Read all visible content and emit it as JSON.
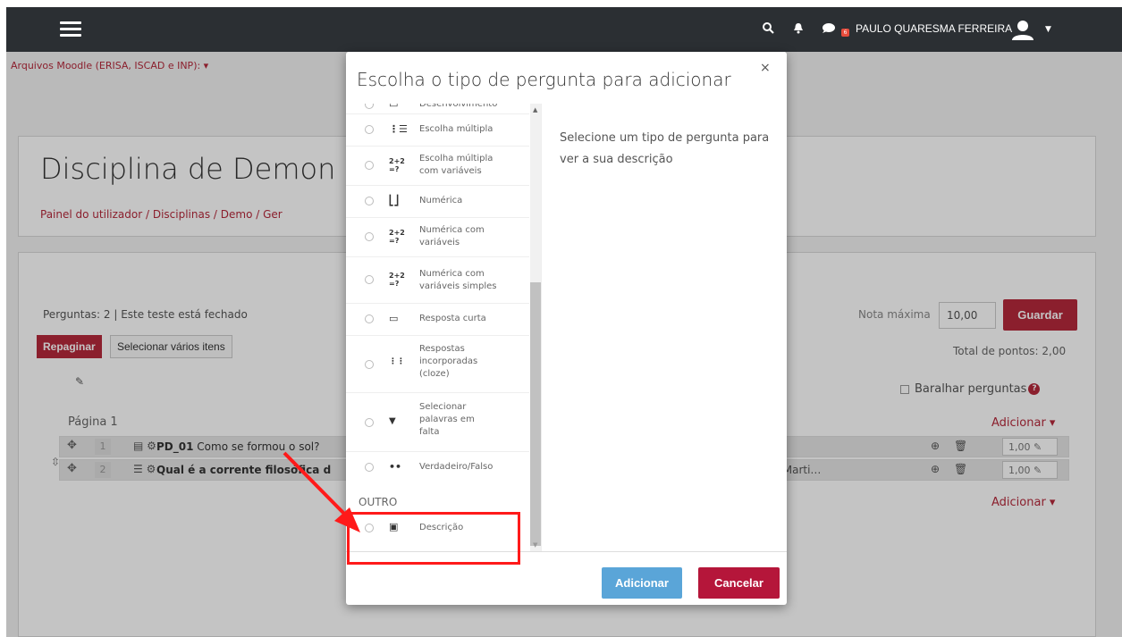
{
  "topbar": {
    "user_name": "PAULO QUARESMA FERREIRA",
    "notification_count": "6"
  },
  "course_menu": "Arquivos Moodle (ERISA, ISCAD e INP): ▾",
  "course": {
    "title": "Disciplina de Demon",
    "breadcrumb": "Painel do utilizador  /  Disciplinas  /  Demo  /  Ger"
  },
  "quiz": {
    "info": "Perguntas: 2 | Este teste está fechado",
    "repaginar": "Repaginar",
    "select_multiple": "Selecionar vários itens",
    "nota_label": "Nota máxima",
    "nota_value": "10,00",
    "guardar": "Guardar",
    "total": "Total de pontos: 2,00",
    "shuffle": "Baralhar perguntas",
    "page": "Página 1",
    "add_label": "Adicionar ▾",
    "questions": [
      {
        "num": "1",
        "name": "PD_01",
        "text": "Como se formou o sol?",
        "extra": "",
        "mark": "1,00"
      },
      {
        "num": "2",
        "name": "",
        "text": "Qual é a corrente filosófica d",
        "extra": "r Marti…",
        "mark": "1,00"
      }
    ]
  },
  "modal": {
    "title": "Escolha o tipo de pergunta para adicionar",
    "close": "×",
    "partial_top": "Desenvolvimento",
    "types": [
      {
        "icon": "⋮☰",
        "label": "Escolha múltipla"
      },
      {
        "icon": "2+2 =?",
        "label": "Escolha múltipla com variáveis"
      },
      {
        "icon": "⎣⎦",
        "label": "Numérica"
      },
      {
        "icon": "2+2 =?",
        "label": "Numérica com variáveis"
      },
      {
        "icon": "2+2 =?",
        "label": "Numérica com variáveis simples"
      },
      {
        "icon": "▭",
        "label": "Resposta curta"
      },
      {
        "icon": "⋮⋮",
        "label": "Respostas incorporadas (cloze)"
      },
      {
        "icon": "▼",
        "label": "Selecionar palavras em falta"
      },
      {
        "icon": "••",
        "label": "Verdadeiro/Falso"
      }
    ],
    "other_header": "OUTRO",
    "other_item": "Descrição",
    "desc_placeholder": "Selecione um tipo de pergunta para ver a sua descrição",
    "btn_add": "Adicionar",
    "btn_cancel": "Cancelar"
  },
  "colors": {
    "brand": "#b5293b",
    "topbar": "#2b2f33",
    "primary_btn": "#5aa5d8",
    "annotation": "#ff1a1a"
  }
}
